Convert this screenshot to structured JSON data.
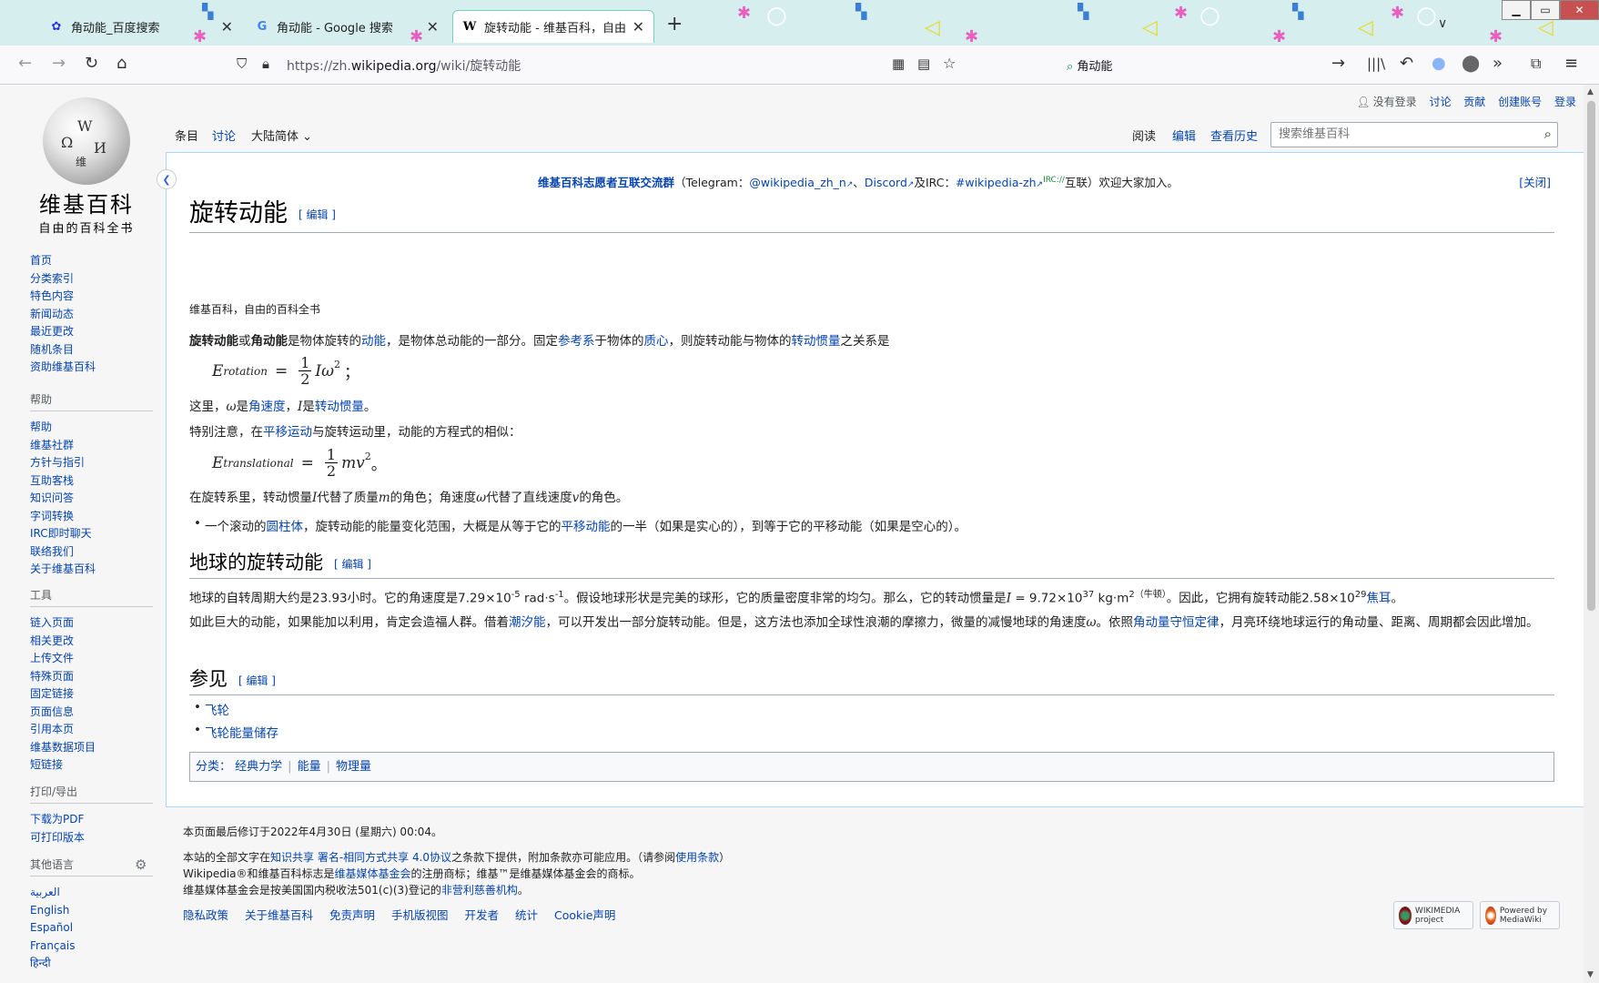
{
  "browser": {
    "tabs": [
      {
        "title": "角动能_百度搜索",
        "favicon": "paw-icon",
        "active": false
      },
      {
        "title": "角动能 - Google 搜索",
        "favicon": "google-g-icon",
        "active": false
      },
      {
        "title": "旋转动能 - 维基百科，自由的百科全书",
        "favicon": "wikipedia-w-icon",
        "active": true
      }
    ],
    "url_prefix": "https://zh.",
    "url_domain": "wikipedia.org",
    "url_path": "/wiki/旋转动能",
    "search_text": "角动能"
  },
  "wiki": {
    "logo_name": "维基百科",
    "logo_tagline": "自由的百科全书",
    "nav_main": [
      "首页",
      "分类索引",
      "特色内容",
      "新闻动态",
      "最近更改",
      "随机条目",
      "资助维基百科"
    ],
    "nav_help": {
      "heading": "帮助",
      "items": [
        "帮助",
        "维基社群",
        "方针与指引",
        "互助客栈",
        "知识问答",
        "字词转换",
        "IRC即时聊天",
        "联络我们",
        "关于维基百科"
      ]
    },
    "nav_tools": {
      "heading": "工具",
      "items": [
        "链入页面",
        "相关更改",
        "上传文件",
        "特殊页面",
        "固定链接",
        "页面信息",
        "引用本页",
        "维基数据项目",
        "短链接"
      ]
    },
    "nav_print": {
      "heading": "打印/导出",
      "items": [
        "下载为PDF",
        "可打印版本"
      ]
    },
    "nav_lang": {
      "heading": "其他语言",
      "items": [
        "العربية",
        "English",
        "Español",
        "Français",
        "हिन्दी"
      ]
    },
    "personal": {
      "not_logged": "没有登录",
      "talk": "讨论",
      "contrib": "贡献",
      "create": "创建账号",
      "login": "登录"
    },
    "tabs_left": {
      "article": "条目",
      "talk": "讨论",
      "variant": "大陆简体"
    },
    "tabs_right": {
      "read": "阅读",
      "edit": "编辑",
      "history": "查看历史"
    },
    "search_placeholder": "搜索维基百科"
  },
  "article": {
    "notice": {
      "bold": "维基百科志愿者互联交流群",
      "open": "（Telegram：",
      "tg": "@wikipedia_zh_n",
      "sep": "、",
      "discord": "Discord",
      "and_irc": "及IRC：",
      "irc": "#wikipedia-zh",
      "irc_sup": "IRC://",
      "rest": "互联）欢迎大家加入。",
      "close": "[关闭]"
    },
    "title": "旋转动能",
    "edit_label": "[ 编辑 ]",
    "site_sub": "维基百科，自由的百科全书",
    "intro": {
      "b1": "旋转动能",
      "t1": "或",
      "b2": "角动能",
      "t2": "是物体旋转的",
      "l1": "动能",
      "t3": "，是物体总动能的一部分。固定",
      "l2": "参考系",
      "t4": "于物体的",
      "l3": "质心",
      "t5": "，则旋转动能与物体的",
      "l4": "转动惯量",
      "t6": "之关系是"
    },
    "eq1": {
      "lhs": "E",
      "sub": "rotation",
      "eqs": "=",
      "num": "1",
      "den": "2",
      "rhs": "Iω",
      "sup": "2",
      "tail": "；"
    },
    "line2": {
      "t1": "这里，",
      "m1": "ω",
      "t2": "是",
      "l1": "角速度",
      "t3": "，",
      "m2": "I",
      "t4": "是",
      "l2": "转动惯量",
      "t5": "。"
    },
    "line3": {
      "t1": "特别注意，在",
      "l1": "平移运动",
      "t2": "与旋转运动里，动能的方程式的相似："
    },
    "eq2": {
      "lhs": "E",
      "sub": "translational",
      "eqs": "=",
      "num": "1",
      "den": "2",
      "rhs": "mv",
      "sup": "2",
      "tail": "。"
    },
    "line4": {
      "t1": "在旋转系里，转动惯量",
      "m1": "I",
      "t2": "代替了质量",
      "m2": "m",
      "t3": "的角色；角速度",
      "m3": "ω",
      "t4": "代替了直线速度",
      "m4": "v",
      "t5": "的角色。"
    },
    "bullet1": {
      "t1": "一个滚动的",
      "l1": "圆柱体",
      "t2": "，旋转动能的能量变化范围，大概是从等于它的",
      "l2": "平移动能",
      "t3": "的一半（如果是实心的），到等于它的平移动能（如果是空心的）。"
    },
    "h2_earth": "地球的旋转动能",
    "earth_p1": {
      "t1": "地球的自转周期大约是23.93小时。它的角速度是7.29×10",
      "s1": "-5",
      "t2": " rad·s",
      "s2": "-1",
      "t3": "。假设地球形状是完美的球形，它的质量密度非常的均匀。那么，它的转动惯量是",
      "m1": "I",
      "t4": " = 9.72×10",
      "s3": "37",
      "t5": " kg·m",
      "s4": "2（牛顿）",
      "t6": "。因此，它拥有旋转动能2.58×10",
      "s5": "29",
      "l1": "焦耳",
      "t7": "。"
    },
    "earth_p2": {
      "t1": "如此巨大的动能，如果能加以利用，肯定会造福人群。借着",
      "l1": "潮汐能",
      "t2": "，可以开发出一部分旋转动能。但是，这方法也添加全球性浪潮的摩擦力，微量的减慢地球的角速度",
      "m1": "ω",
      "t3": "。依照",
      "l2": "角动量守恒定律",
      "t4": "，月亮环绕地球运行的角动量、距离、周期都会因此增加。"
    },
    "h2_see": "参见",
    "see_also": [
      "飞轮",
      "飞轮能量储存"
    ],
    "categories_label": "分类：",
    "categories": [
      "经典力学",
      "能量",
      "物理量"
    ]
  },
  "footer": {
    "modified": "本页面最后修订于2022年4月30日 (星期六) 00:04。",
    "l1": {
      "t1": "本站的全部文字在",
      "l1": "知识共享 署名-相同方式共享 4.0协议",
      "t2": "之条款下提供，附加条款亦可能应用。（请参阅",
      "l2": "使用条款",
      "t3": "）"
    },
    "l2": {
      "t1": "Wikipedia®和维基百科标志是",
      "l1": "维基媒体基金会",
      "t2": "的注册商标；维基™是维基媒体基金会的商标。"
    },
    "l3": {
      "t1": "维基媒体基金会是按美国国内税收法501(c)(3)登记的",
      "l1": "非营利慈善机构",
      "t2": "。"
    },
    "links": [
      "隐私政策",
      "关于维基百科",
      "免责声明",
      "手机版视图",
      "开发者",
      "统计",
      "Cookie声明"
    ],
    "badge1": "WIKIMEDIA project",
    "badge2": "Powered by MediaWiki"
  }
}
